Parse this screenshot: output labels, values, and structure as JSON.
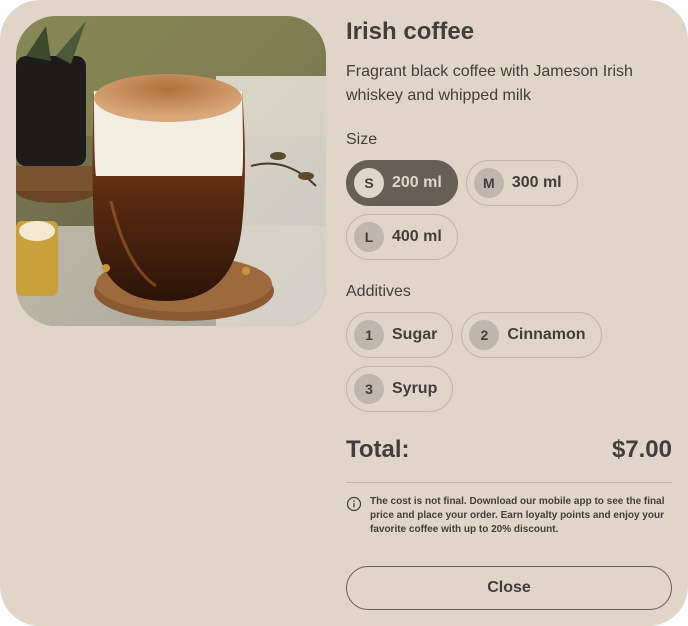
{
  "product": {
    "title": "Irish coffee",
    "description": "Fragrant black coffee with Jameson Irish whiskey and whipped milk",
    "image_icon": "coffee-photo"
  },
  "size": {
    "label": "Size",
    "options": [
      {
        "badge": "S",
        "label": "200 ml",
        "active": true
      },
      {
        "badge": "M",
        "label": "300 ml",
        "active": false
      },
      {
        "badge": "L",
        "label": "400 ml",
        "active": false
      }
    ]
  },
  "additives": {
    "label": "Additives",
    "options": [
      {
        "badge": "1",
        "label": "Sugar",
        "active": false
      },
      {
        "badge": "2",
        "label": "Cinnamon",
        "active": false
      },
      {
        "badge": "3",
        "label": "Syrup",
        "active": false
      }
    ]
  },
  "total": {
    "label": "Total:",
    "value": "$7.00"
  },
  "note": {
    "icon": "info-icon",
    "text": "The cost is not final. Download our mobile app to see the final price and place your order. Earn loyalty points and enjoy your favorite coffee with up to 20% discount."
  },
  "close_label": "Close",
  "colors": {
    "background": "#e1d4c9",
    "text": "#403f3d",
    "accent": "#665f55",
    "border": "#c1b6ad"
  }
}
